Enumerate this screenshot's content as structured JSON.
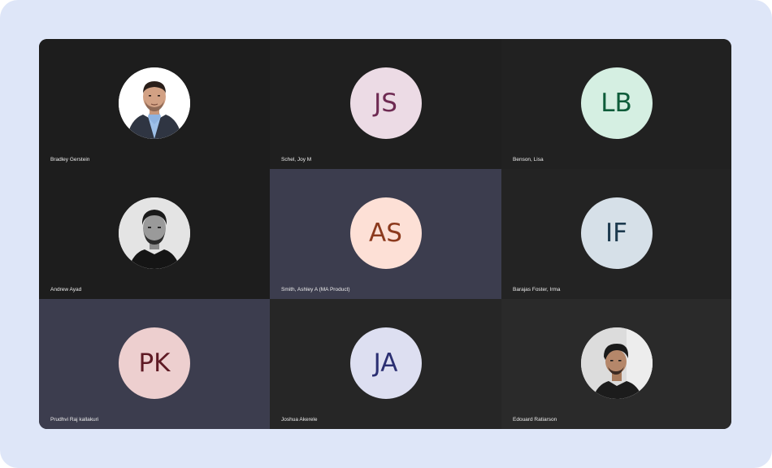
{
  "participants": [
    {
      "name": "Bradley Gerstein",
      "kind": "photo",
      "photo": "man-suit-icon",
      "tile_bg": "#1d1d1d"
    },
    {
      "name": "Schel, Joy M",
      "kind": "initials",
      "initials": "JS",
      "avatar_bg": "#ecdbe5",
      "initials_color": "#6e2a52",
      "tile_bg": "#1f1f1f"
    },
    {
      "name": "Benson, Lisa",
      "kind": "initials",
      "initials": "LB",
      "avatar_bg": "#d5efe2",
      "initials_color": "#0e5c3a",
      "tile_bg": "#212121"
    },
    {
      "name": "Andrew Ayad",
      "kind": "photo",
      "photo": "man-bw-icon",
      "tile_bg": "#1d1d1d"
    },
    {
      "name": "Smith, Ashley A (MA Product)",
      "kind": "initials",
      "initials": "AS",
      "avatar_bg": "#fde0d6",
      "initials_color": "#8c3a1e",
      "tile_bg": "#3c3d4e"
    },
    {
      "name": "Barajas Foster, Irma",
      "kind": "initials",
      "initials": "IF",
      "avatar_bg": "#d6e0e8",
      "initials_color": "#1d3a4e",
      "tile_bg": "#232323"
    },
    {
      "name": "Prudhvi Raj kallakuri",
      "kind": "initials",
      "initials": "PK",
      "avatar_bg": "#edcfcf",
      "initials_color": "#5e1a24",
      "tile_bg": "#3c3d4e"
    },
    {
      "name": "Joshua Akerele",
      "kind": "initials",
      "initials": "JA",
      "avatar_bg": "#dddff1",
      "initials_color": "#2b2f72",
      "tile_bg": "#262626"
    },
    {
      "name": "Edouard Ratiarson",
      "kind": "photo",
      "photo": "man-cap-icon",
      "tile_bg": "#2a2a2a"
    }
  ]
}
